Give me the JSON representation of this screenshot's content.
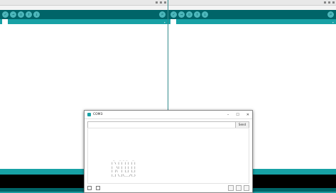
{
  "left_window": {
    "title": "",
    "menu": [
      "",
      "",
      "",
      "",
      ""
    ],
    "tab_label": "",
    "code_lines": [
      "",
      "",
      "",
      "",
      "",
      "",
      "",
      "",
      "",
      "",
      "",
      "",
      "",
      "",
      "",
      "",
      "",
      "",
      "",
      "",
      "",
      "",
      "",
      "",
      "",
      "",
      "",
      "",
      "",
      "",
      "",
      ""
    ]
  },
  "right_window": {
    "title": "",
    "menu": [
      "",
      "",
      "",
      "",
      ""
    ],
    "board_label": "",
    "tab_label": "",
    "code_lines": [
      "",
      "",
      "",
      "",
      "",
      "",
      "",
      "",
      "",
      "",
      "",
      "",
      "",
      "",
      "",
      "",
      "",
      "",
      "",
      "",
      "",
      "",
      "",
      "",
      "",
      "",
      "",
      "",
      "",
      "",
      "",
      ""
    ]
  },
  "toolbar_icons": [
    "verify-icon",
    "upload-icon",
    "new-icon",
    "open-icon",
    "save-icon",
    "serial-monitor-icon"
  ],
  "serial_monitor": {
    "title": "COM3",
    "send_label": "Send",
    "input_value": "",
    "output_lines": [
      "",
      "",
      "",
      "",
      "",
      "",
      "",
      "              _   _ _ _   _",
      "             | \\ | | | | | |",
      "             |  \\| | | | | |",
      "             | |\\  | |_| |_|",
      "             |_| \\_|\\___/(_)",
      "",
      "",
      ""
    ],
    "autoscroll_label": "",
    "timestamp_label": "",
    "line_ending": "",
    "baud_rate": "",
    "clear_label": ""
  },
  "colors": {
    "teal": "#17a1a5",
    "dark_teal": "#006468",
    "console": "#000000"
  }
}
